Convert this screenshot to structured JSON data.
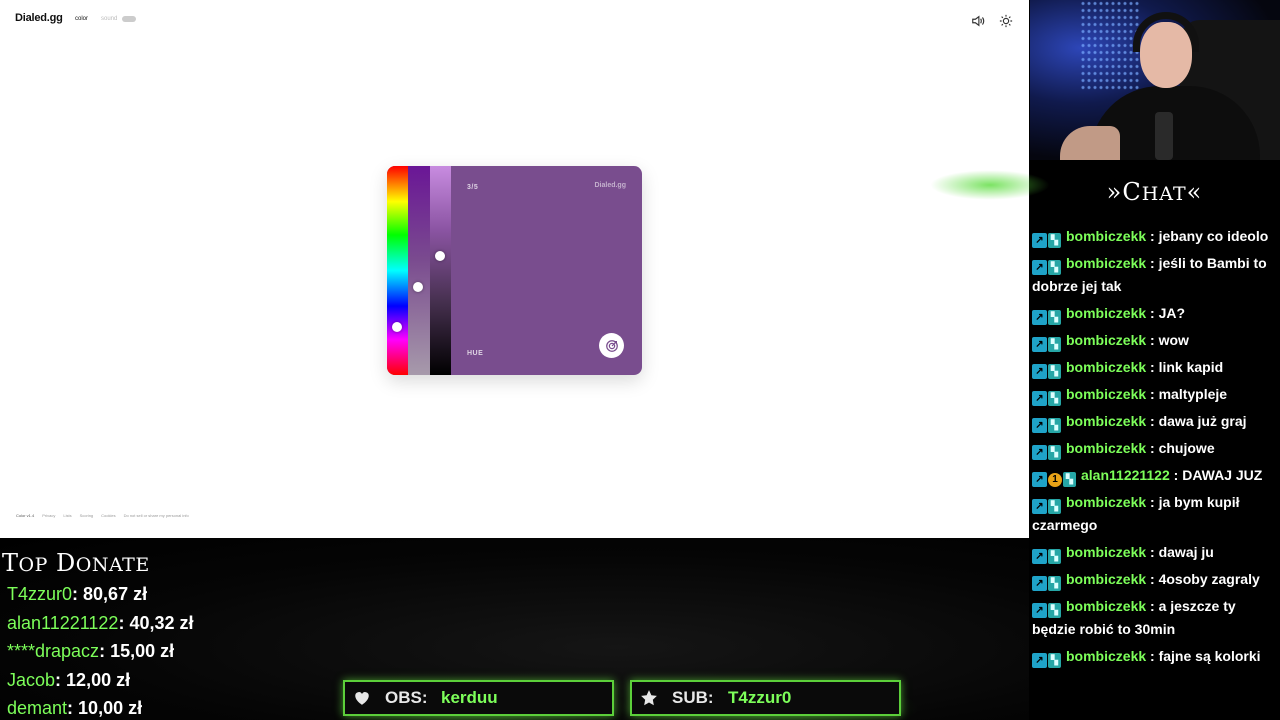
{
  "browser": {
    "logo": "Dialed.gg",
    "nav": {
      "color": "color",
      "sound": "sound"
    },
    "icons": {
      "sound": "speaker-icon",
      "theme": "sun-icon"
    },
    "game": {
      "round": "3/5",
      "brand": "Dialed.gg",
      "slider_label": "HUE",
      "swatch_color": "#794d8e",
      "submit_icon": "target-icon",
      "hue_level": 0.77,
      "saturation_level": 0.58,
      "lightness_level": 0.43
    },
    "footer_links": [
      "Color v1.4",
      "Privacy",
      "Lists",
      "Scoring",
      "Cookies",
      "Do not sell or share my personal info"
    ]
  },
  "chat": {
    "title_first": "»C",
    "title_rest": "HAT",
    "title_end": "«",
    "messages": [
      {
        "user": "bombiczekk",
        "text": "jebany co ideolo",
        "sub_badge": false
      },
      {
        "user": "bombiczekk",
        "text": "jeśli to Bambi to dobrze jej tak",
        "sub_badge": false
      },
      {
        "user": "bombiczekk",
        "text": "JA?",
        "sub_badge": false
      },
      {
        "user": "bombiczekk",
        "text": "wow",
        "sub_badge": false
      },
      {
        "user": "bombiczekk",
        "text": "link kapid",
        "sub_badge": false
      },
      {
        "user": "bombiczekk",
        "text": "maltypleje",
        "sub_badge": false
      },
      {
        "user": "bombiczekk",
        "text": "dawa już graj",
        "sub_badge": false
      },
      {
        "user": "bombiczekk",
        "text": "chujowe",
        "sub_badge": false
      },
      {
        "user": "alan11221122",
        "text": "DAWAJ JUZ",
        "sub_badge": true
      },
      {
        "user": "bombiczekk",
        "text": "ja bym kupił czarmego",
        "sub_badge": false
      },
      {
        "user": "bombiczekk",
        "text": "dawaj ju",
        "sub_badge": false
      },
      {
        "user": "bombiczekk",
        "text": "4osoby zagraly",
        "sub_badge": false
      },
      {
        "user": "bombiczekk",
        "text": "a jeszcze ty będzie robić to 30min",
        "sub_badge": false
      },
      {
        "user": "bombiczekk",
        "text": "fajne są kolorki",
        "sub_badge": false
      }
    ]
  },
  "top_donate": {
    "title_first": "T",
    "title_rest1": "OP",
    "title_d": " D",
    "title_rest2": "ONATE",
    "entries": [
      {
        "name": "T4zzur0",
        "amount": "80,67 zł"
      },
      {
        "name": "alan11221122",
        "amount": "40,32 zł"
      },
      {
        "name": "****drapacz",
        "amount": "15,00 zł"
      },
      {
        "name": "Jacob",
        "amount": "12,00 zł"
      },
      {
        "name": "demant",
        "amount": "10,00 zł"
      }
    ]
  },
  "obs_bar": {
    "label": "OBS:",
    "value": "kerduu",
    "icon": "heart-icon"
  },
  "sub_bar": {
    "label": "SUB:",
    "value": "T4zzur0",
    "icon": "star-icon"
  },
  "colors": {
    "accent_green": "#7dff5a",
    "chat_bg": "#000000",
    "card_color": "#794d8e"
  }
}
